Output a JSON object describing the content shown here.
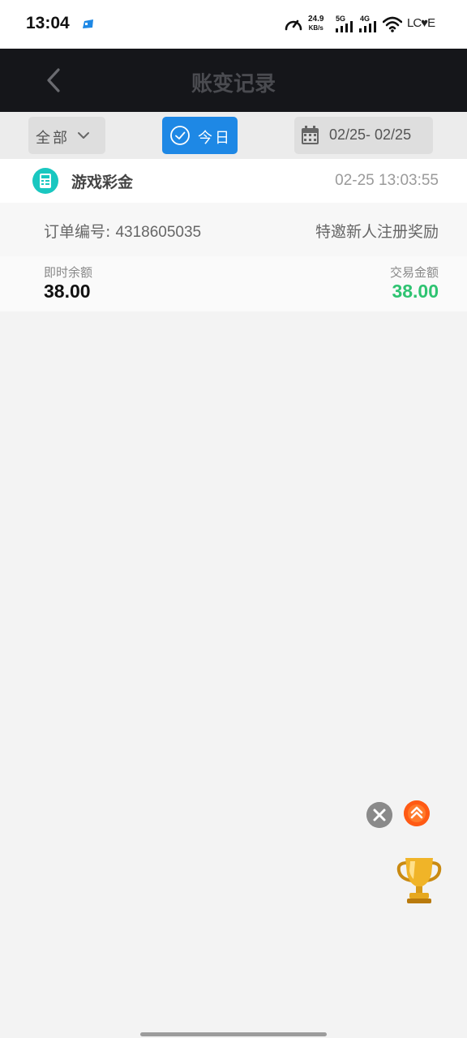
{
  "status_bar": {
    "time": "13:04",
    "net_speed": "24.9",
    "net_speed_unit": "KB/s",
    "sim1_label": "5G",
    "sim2_label": "4G",
    "carrier": "LC♥E",
    "icons": [
      "app-notification-icon",
      "speedometer-icon",
      "signal-icon",
      "signal-icon",
      "wifi-icon"
    ]
  },
  "header": {
    "title": "账变记录",
    "back_icon": "chevron-left-icon"
  },
  "filters": {
    "all_label": "全部",
    "all_icon": "chevron-down-icon",
    "today_label": "今日",
    "today_icon": "check-circle-icon",
    "date_range": "02/25- 02/25",
    "date_icon": "calendar-icon",
    "today_color": "#1e88e5"
  },
  "records": [
    {
      "type": "游戏彩金",
      "icon": "wallet-icon",
      "datetime": "02-25 13:03:55",
      "order_label": "订单编号: ",
      "order_no": "4318605035",
      "description": "特邀新人注册奖励",
      "balance_label": "即时余额",
      "balance": "38.00",
      "amount_label": "交易金额",
      "amount": "38.00",
      "amount_color": "#2ec371"
    }
  ],
  "floating": {
    "close_icon": "close-icon",
    "scroll_top_icon": "double-chevron-up-icon",
    "trophy_icon": "trophy-icon"
  }
}
